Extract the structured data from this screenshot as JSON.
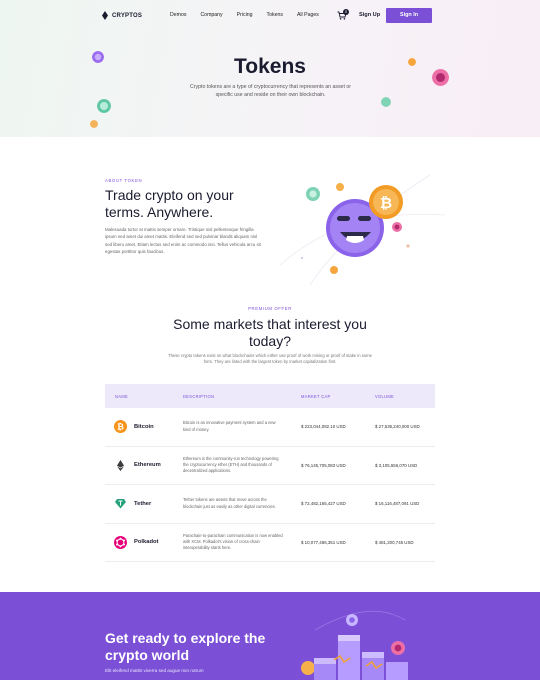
{
  "nav": {
    "brand": "CRYPTOS",
    "menu": [
      "Demos",
      "Company",
      "Pricing",
      "Tokens",
      "All Pages"
    ],
    "cart_count": "0",
    "signup": "Sign Up",
    "signin": "Sign In"
  },
  "hero": {
    "title": "Tokens",
    "description": "Crypto tokens are a type of cryptocurrency that represents an asset or specific use and reside on their own blockchain."
  },
  "about": {
    "eyebrow": "ABOUT TOKEN",
    "title": "Trade crypto on your terms. Anywhere.",
    "text": "Malesuada tortor at mattis semper ornare. Tristique nisl pellentesque fringilla ipsum sed amet dui amet mattis. Eleifend sed sed pulvinar blandit aliquam nisl sed libero amet. Etiam lectus sed enim ac commodo nisi. Tellus vehicula arcu sit egestas porttitor quis faucibus."
  },
  "markets": {
    "eyebrow": "PREMIUM OFFER",
    "title": "Some markets that interest you today?",
    "description": "These crypto tokens exist on what blockchains which either use proof of work mining or proof of stake in some form. They are listed with the largest token by market capitalization first.",
    "columns": {
      "name": "NAME",
      "description": "DESCRIPTION",
      "market_cap": "MARKET CAP",
      "volume": "VOLUME"
    },
    "rows": [
      {
        "name": "Bitcoin",
        "icon": "bitcoin-icon",
        "color": "#f7931a",
        "description": "Bitcoin is an innovative payment system and a new kind of money.",
        "market_cap": "$ 223,044,082.10 USD",
        "volume": "$ 27,536,240,000 USD"
      },
      {
        "name": "Ethereum",
        "icon": "ethereum-icon",
        "color": "#3c3c3d",
        "description": "Ethereum is the community-run technology powering the cryptocurrency ether (ETH) and thousands of decentralized applications.",
        "market_cap": "$ 76,145,705,083 USD",
        "volume": "$ 3,105,556,070 USD"
      },
      {
        "name": "Tether",
        "icon": "tether-icon",
        "color": "#26a17b",
        "description": "Tether tokens are assets that move across the blockchain just as easily as other digital currencies.",
        "market_cap": "$ 72,482,165,427 USD",
        "volume": "$ 16,116,487,091 USD"
      },
      {
        "name": "Polkadot",
        "icon": "polkadot-icon",
        "color": "#e6007a",
        "description": "Parachain-to-parachain communication is now enabled with XCM. Polkadot's vision of cross-chain interoperability starts here.",
        "market_cap": "$ 10,077,486,351 USD",
        "volume": "$ 481,200,745 USD"
      }
    ]
  },
  "cta": {
    "title": "Get ready to explore the crypto world",
    "text": "Elit eleifend mattis viverra sed augue non rutrum"
  },
  "colors": {
    "accent": "#7b4fd6",
    "heading": "#1b1b2f"
  }
}
